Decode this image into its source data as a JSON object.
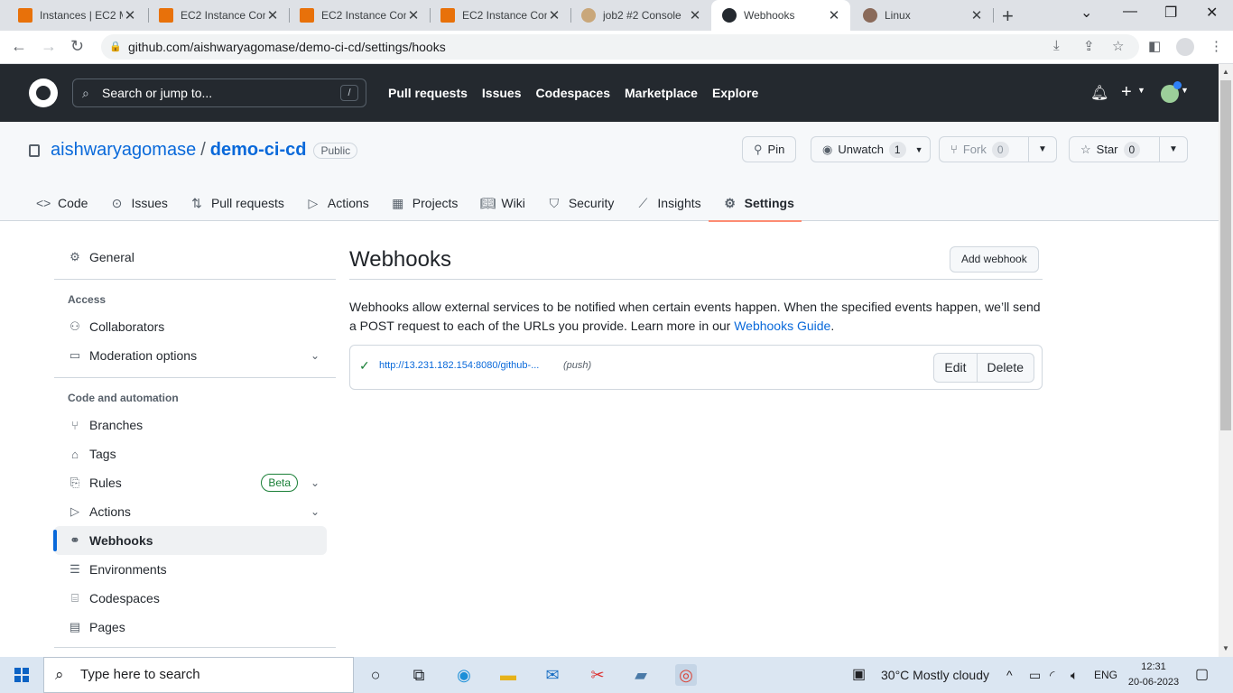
{
  "browser": {
    "tabs": [
      {
        "title": "Instances | EC2 M",
        "favicon_color": "#e8710a"
      },
      {
        "title": "EC2 Instance Con",
        "favicon_color": "#e8710a"
      },
      {
        "title": "EC2 Instance Con",
        "favicon_color": "#e8710a"
      },
      {
        "title": "EC2 Instance Con",
        "favicon_color": "#e8710a"
      },
      {
        "title": "job2 #2 Console",
        "favicon_color": "#c9a77a"
      },
      {
        "title": "Webhooks",
        "favicon_color": "#24292f"
      },
      {
        "title": "Linux",
        "favicon_color": "#8a6a5a"
      }
    ],
    "active_tab": 5,
    "url": "github.com/aishwaryagomase/demo-ci-cd/settings/hooks"
  },
  "github": {
    "search_placeholder": "Search or jump to...",
    "search_shortcut": "/",
    "nav": [
      "Pull requests",
      "Issues",
      "Codespaces",
      "Marketplace",
      "Explore"
    ]
  },
  "repo": {
    "owner": "aishwaryagomase",
    "separator": "/",
    "name": "demo-ci-cd",
    "visibility": "Public",
    "pin_label": "Pin",
    "unwatch_label": "Unwatch",
    "unwatch_count": "1",
    "fork_label": "Fork",
    "fork_count": "0",
    "star_label": "Star",
    "star_count": "0",
    "tabs": [
      {
        "label": "Code",
        "icon": "code-icon"
      },
      {
        "label": "Issues",
        "icon": "issue-icon"
      },
      {
        "label": "Pull requests",
        "icon": "pull-request-icon"
      },
      {
        "label": "Actions",
        "icon": "play-icon"
      },
      {
        "label": "Projects",
        "icon": "table-icon"
      },
      {
        "label": "Wiki",
        "icon": "book-icon"
      },
      {
        "label": "Security",
        "icon": "shield-icon"
      },
      {
        "label": "Insights",
        "icon": "graph-icon"
      },
      {
        "label": "Settings",
        "icon": "gear-icon"
      }
    ],
    "selected_tab": "Settings"
  },
  "sidebar": {
    "general": "General",
    "access_heading": "Access",
    "access_items": [
      "Collaborators",
      "Moderation options"
    ],
    "code_heading": "Code and automation",
    "code_items": [
      "Branches",
      "Tags",
      "Rules",
      "Actions",
      "Webhooks",
      "Environments",
      "Codespaces",
      "Pages"
    ],
    "beta_badge": "Beta",
    "selected": "Webhooks"
  },
  "main": {
    "title": "Webhooks",
    "add_button": "Add webhook",
    "description": "Webhooks allow external services to be notified when certain events happen. When the specified events happen, we’ll send a POST request to each of the URLs you provide. Learn more in our ",
    "guide_link": "Webhooks Guide",
    "description_end": ".",
    "hooks": [
      {
        "url": "http://13.231.182.154:8080/github-...",
        "events": "(push)",
        "status": "ok"
      }
    ],
    "edit_label": "Edit",
    "delete_label": "Delete"
  },
  "taskbar": {
    "search_placeholder": "Type here to search",
    "weather": "30°C  Mostly cloudy",
    "language": "ENG",
    "time": "12:31",
    "date": "20-06-2023"
  }
}
